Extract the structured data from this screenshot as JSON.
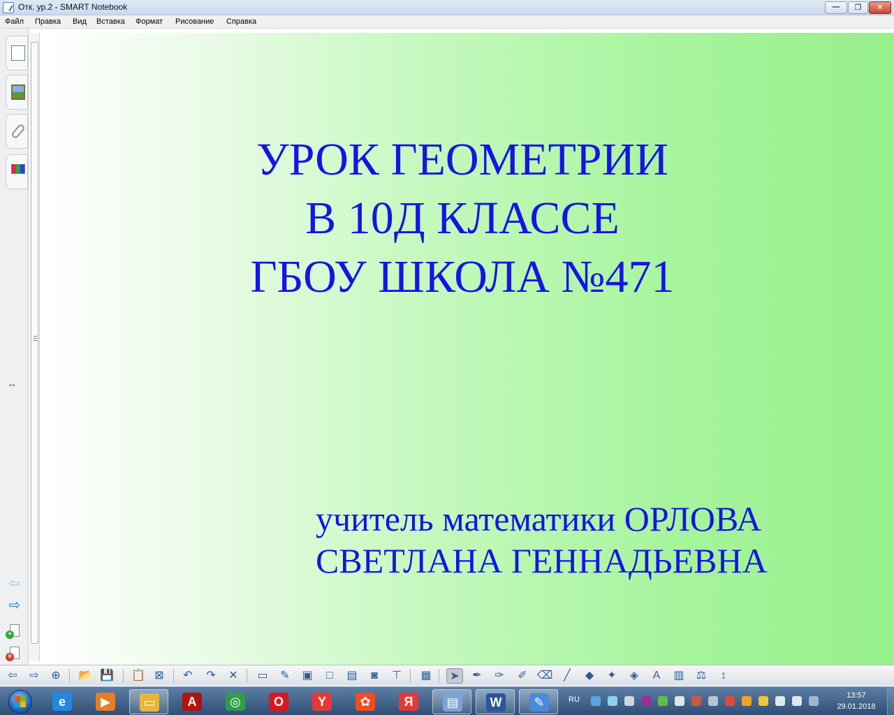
{
  "window": {
    "title": "Отк. ур.2 - SMART Notebook",
    "min_icon": "minimize-icon",
    "max_icon": "restore-icon",
    "close_icon": "close-icon",
    "min_glyph": "—",
    "max_glyph": "❐",
    "close_glyph": "✕"
  },
  "menu": [
    "Файл",
    "Правка",
    "Вид",
    "Вставка",
    "Формат",
    "Рисование",
    "Справка"
  ],
  "sidebar": {
    "tabs": [
      "page-sorter-icon",
      "gallery-icon",
      "attachments-icon",
      "properties-icon"
    ],
    "resize_glyph": "↔",
    "prev_glyph": "⇦",
    "next_glyph": "⇨",
    "add_glyph": "+",
    "delete_glyph": "×"
  },
  "page": {
    "title_lines": [
      "УРОК ГЕОМЕТРИИ",
      "В 10Д КЛАССЕ",
      "ГБОУ ШКОЛА №471"
    ],
    "author_lines": [
      "учитель математики  ОРЛОВА",
      "СВЕТЛАНА ГЕННАДЬЕВНА"
    ],
    "text_color": "#1414e8",
    "gradient_end_color": "#97f08a"
  },
  "toolbar": {
    "buttons": [
      {
        "name": "previous-page-icon",
        "glyph": "⇦"
      },
      {
        "name": "next-page-icon",
        "glyph": "⇨"
      },
      {
        "name": "add-page-icon",
        "glyph": "⊕"
      },
      {
        "name": "open-file-icon",
        "glyph": "📂"
      },
      {
        "name": "save-icon",
        "glyph": "💾"
      },
      {
        "name": "paste-icon",
        "glyph": "📋"
      },
      {
        "name": "full-screen-close-icon",
        "glyph": "⊠"
      },
      {
        "name": "undo-icon",
        "glyph": "↶"
      },
      {
        "name": "redo-icon",
        "glyph": "↷"
      },
      {
        "name": "delete-icon",
        "glyph": "✕"
      },
      {
        "name": "screen-shade-icon",
        "glyph": "▭"
      },
      {
        "name": "pens-icon",
        "glyph": "✎"
      },
      {
        "name": "full-screen-icon",
        "glyph": "▣"
      },
      {
        "name": "transparent-background-icon",
        "glyph": "□"
      },
      {
        "name": "display-icon",
        "glyph": "▤"
      },
      {
        "name": "capture-icon",
        "glyph": "◙"
      },
      {
        "name": "document-camera-icon",
        "glyph": "⊤"
      },
      {
        "name": "table-icon",
        "glyph": "▦"
      },
      {
        "name": "select-icon",
        "glyph": "➤"
      },
      {
        "name": "pen-icon",
        "glyph": "✒"
      },
      {
        "name": "creative-pen-icon",
        "glyph": "✑"
      },
      {
        "name": "magic-pen-icon",
        "glyph": "✐"
      },
      {
        "name": "eraser-icon",
        "glyph": "⌫"
      },
      {
        "name": "line-icon",
        "glyph": "╱"
      },
      {
        "name": "shapes-icon",
        "glyph": "◆"
      },
      {
        "name": "magic-wand-icon",
        "glyph": "✦"
      },
      {
        "name": "fill-icon",
        "glyph": "◈"
      },
      {
        "name": "text-icon",
        "glyph": "A"
      },
      {
        "name": "properties-icon",
        "glyph": "▥"
      },
      {
        "name": "measurement-tools-icon",
        "glyph": "⚖"
      },
      {
        "name": "toolbar-move-icon",
        "glyph": "↕"
      }
    ]
  },
  "taskbar": {
    "apps": [
      {
        "name": "internet-explorer-icon",
        "glyph": "e",
        "color": "#1e88e5"
      },
      {
        "name": "media-player-icon",
        "glyph": "▶",
        "color": "#e67e22"
      },
      {
        "name": "file-explorer-icon",
        "glyph": "▭",
        "color": "#e8b53c"
      },
      {
        "name": "adobe-reader-icon",
        "glyph": "A",
        "color": "#b3120f"
      },
      {
        "name": "chrome-icon",
        "glyph": "◎",
        "color": "#2e9e49"
      },
      {
        "name": "opera-icon",
        "glyph": "O",
        "color": "#e0151c"
      },
      {
        "name": "yandex-browser-icon",
        "glyph": "Y",
        "color": "#e53935"
      },
      {
        "name": "film-reel-icon",
        "glyph": "✿",
        "color": "#f24d1b"
      },
      {
        "name": "yandex-icon",
        "glyph": "Я",
        "color": "#e53935"
      },
      {
        "name": "notebook-gallery-icon",
        "glyph": "▤",
        "color": "#7aa4d6"
      },
      {
        "name": "word-icon",
        "glyph": "W",
        "color": "#2b5797"
      },
      {
        "name": "smart-notebook-icon",
        "glyph": "✎",
        "color": "#4a8ad6"
      }
    ],
    "language": "RU",
    "time": "13:57",
    "date": "29.01.2018"
  }
}
